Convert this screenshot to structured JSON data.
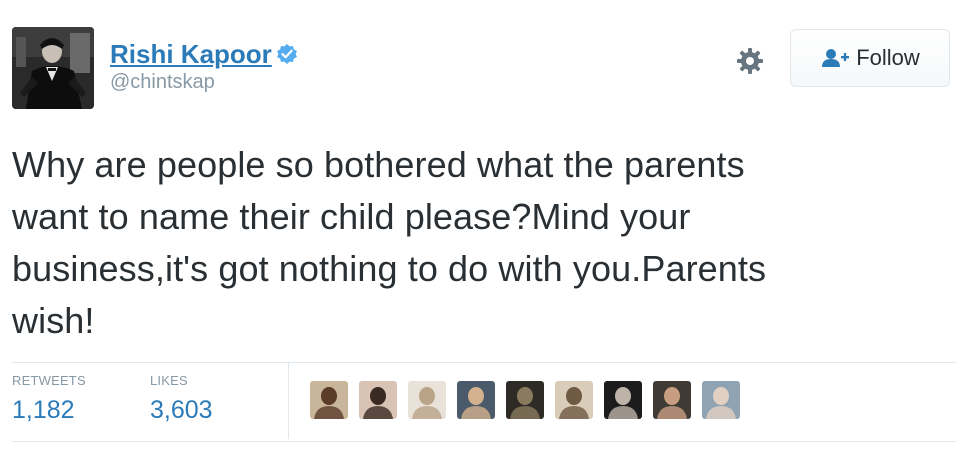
{
  "user": {
    "display_name": "Rishi Kapoor",
    "handle": "@chintskap",
    "verified": true,
    "avatar_icon": "profile-photo"
  },
  "actions": {
    "settings_icon": "gear-icon",
    "follow_label": "Follow",
    "follow_icon": "add-user-icon"
  },
  "tweet": {
    "lines": [
      "Why are people so bothered what the parents",
      "want to name their child please?Mind your",
      "business,it's got nothing to do with you.Parents",
      "wish!"
    ]
  },
  "stats": {
    "retweets_label": "RETWEETS",
    "retweets_value": "1,182",
    "likes_label": "LIKES",
    "likes_value": "3,603"
  },
  "likers": [
    {
      "name": "liker-1",
      "bg": "#c9b69a",
      "fg": "#5b3b2a"
    },
    {
      "name": "liker-2",
      "bg": "#d8c3b4",
      "fg": "#3a2a24"
    },
    {
      "name": "liker-3",
      "bg": "#e9e2d8",
      "fg": "#b9a488"
    },
    {
      "name": "liker-4",
      "bg": "#4a5a6a",
      "fg": "#d3b08e"
    },
    {
      "name": "liker-5",
      "bg": "#2e2a25",
      "fg": "#8a7a5e"
    },
    {
      "name": "liker-6",
      "bg": "#d9cdb9",
      "fg": "#6f5a44"
    },
    {
      "name": "liker-7",
      "bg": "#1c1c1c",
      "fg": "#bdb3a8"
    },
    {
      "name": "liker-8",
      "bg": "#3f3a33",
      "fg": "#c79e82"
    },
    {
      "name": "liker-9",
      "bg": "#8fa3b2",
      "fg": "#e2d0c2"
    }
  ],
  "colors": {
    "link": "#2b7bb9",
    "text": "#292f33",
    "muted": "#8899a6",
    "border": "#e1e8ed",
    "verified": "#55acee"
  }
}
